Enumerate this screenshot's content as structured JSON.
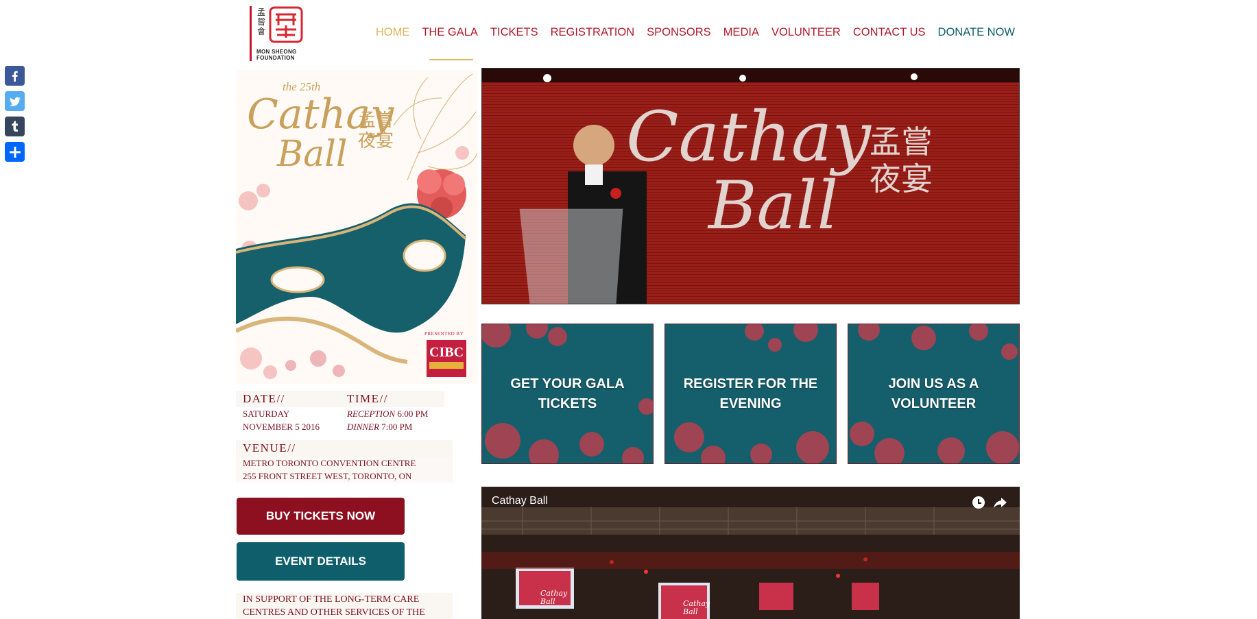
{
  "share": {
    "items": [
      {
        "name": "facebook"
      },
      {
        "name": "twitter"
      },
      {
        "name": "tumblr"
      },
      {
        "name": "share"
      }
    ]
  },
  "logo": {
    "cjk": "孟嘗會",
    "text_line1": "MON SHEONG",
    "text_line2": "FOUNDATION"
  },
  "nav": {
    "items": [
      {
        "label": "HOME"
      },
      {
        "label": "THE GALA"
      },
      {
        "label": "TICKETS"
      },
      {
        "label": "REGISTRATION"
      },
      {
        "label": "SPONSORS"
      },
      {
        "label": "MEDIA"
      },
      {
        "label": "VOLUNTEER"
      },
      {
        "label": "CONTACT US"
      },
      {
        "label": "DONATE NOW"
      }
    ]
  },
  "poster": {
    "edition": "the 25th",
    "title_line1": "Cathay",
    "title_line2": "Ball",
    "cjk_title": "孟嘗夜宴",
    "presented_by": "PRESENTED BY",
    "sponsor": "CIBC"
  },
  "event": {
    "date_label": "DATE//",
    "date_line1": "SATURDAY",
    "date_line2": "NOVEMBER 5 2016",
    "time_label": "TIME//",
    "reception_label": "RECEPTION",
    "reception_time": "6:00 PM",
    "dinner_label": "DINNER",
    "dinner_time": "7:00 PM",
    "venue_label": "VENUE//",
    "venue_line1": "METRO TORONTO CONVENTION CENTRE",
    "venue_line2": "255 FRONT STREET WEST, TORONTO, ON"
  },
  "buttons": {
    "buy": "BUY TICKETS NOW",
    "details": "EVENT DETAILS"
  },
  "support_text": "IN SUPPORT OF THE LONG-TERM CARE CENTRES AND OTHER SERVICES OF THE MON SHEONG FOUNDATION",
  "hero": {
    "title_line1": "Cathay",
    "title_line2": "Ball",
    "cjk_title": "孟嘗夜宴"
  },
  "tiles": [
    {
      "label": "GET YOUR GALA TICKETS"
    },
    {
      "label": "REGISTER FOR THE EVENING"
    },
    {
      "label": "JOIN US AS A VOLUNTEER"
    }
  ],
  "video": {
    "title": "Cathay Ball",
    "screen_label": "Cathay Ball"
  },
  "colors": {
    "brand_red": "#b3182a",
    "active_gold": "#e0b15c",
    "teal": "#0f5e6b",
    "dark_red": "#8c1020"
  }
}
